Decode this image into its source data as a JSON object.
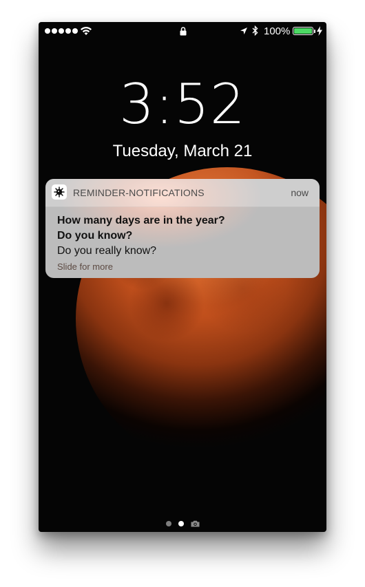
{
  "status_bar": {
    "battery_percent": "100%",
    "battery_color": "#4cd964"
  },
  "lockscreen": {
    "time": "3:52",
    "date": "Tuesday, March 21"
  },
  "notification": {
    "app_name": "REMINDER-NOTIFICATIONS",
    "timestamp": "now",
    "title": "How many days are in the year?",
    "subtitle": "Do you know?",
    "body": "Do you really know?",
    "hint": "Slide for more",
    "app_icon": "virus-icon"
  },
  "page_indicator": {
    "pages": 2,
    "active_page": 2,
    "camera_icon": "camera-icon"
  },
  "wallpaper": {
    "accent": "#c04f1c"
  }
}
